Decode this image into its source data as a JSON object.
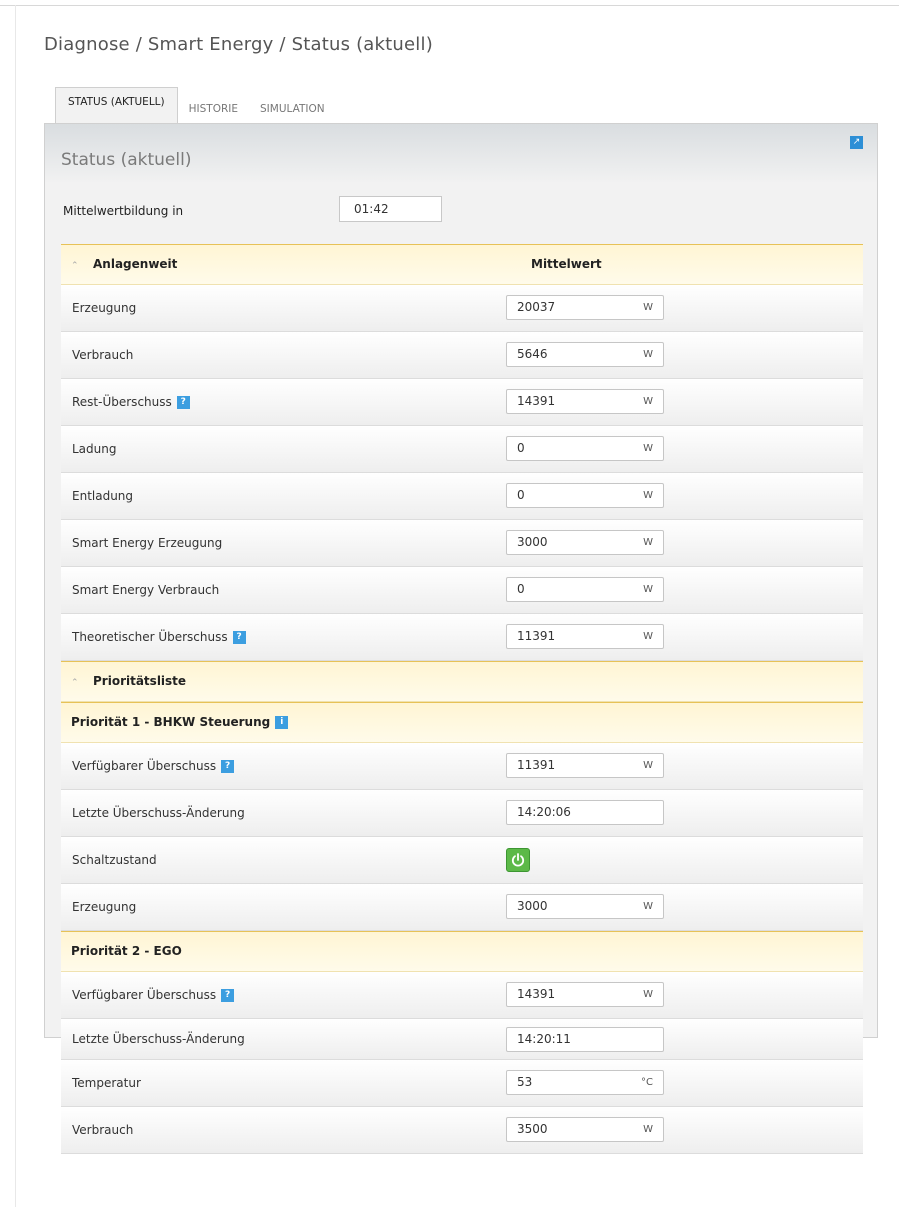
{
  "breadcrumb": "Diagnose / Smart Energy / Status (aktuell)",
  "tabs": [
    {
      "label": "STATUS (AKTUELL)",
      "active": true
    },
    {
      "label": "HISTORIE",
      "active": false
    },
    {
      "label": "SIMULATION",
      "active": false
    }
  ],
  "panel_title": "Status (aktuell)",
  "averaging": {
    "label": "Mittelwertbildung in",
    "value": "01:42"
  },
  "plant": {
    "header_label": "Anlagenweit",
    "column_header": "Mittelwert",
    "rows": [
      {
        "label": "Erzeugung",
        "value": "20037",
        "unit": "W"
      },
      {
        "label": "Verbrauch",
        "value": "5646",
        "unit": "W"
      },
      {
        "label": "Rest-Überschuss",
        "value": "14391",
        "unit": "W"
      },
      {
        "label": "Ladung",
        "value": "0",
        "unit": "W"
      },
      {
        "label": "Entladung",
        "value": "0",
        "unit": "W"
      },
      {
        "label": "Smart Energy Erzeugung",
        "value": "3000",
        "unit": "W"
      },
      {
        "label": "Smart Energy Verbrauch",
        "value": "0",
        "unit": "W"
      },
      {
        "label": "Theoretischer Überschuss",
        "value": "11391",
        "unit": "W"
      }
    ]
  },
  "priority_list": {
    "header_label": "Prioritätsliste",
    "p1": {
      "title": "Priorität 1 - BHKW Steuerung",
      "rows": [
        {
          "label": "Verfügbarer Überschuss",
          "value": "11391",
          "unit": "W"
        },
        {
          "label": "Letzte Überschuss-Änderung",
          "value": "14:20:06"
        },
        {
          "label": "Schaltzustand",
          "state": "on"
        },
        {
          "label": "Erzeugung",
          "value": "3000",
          "unit": "W"
        }
      ]
    },
    "p2": {
      "title": "Priorität 2 - EGO",
      "rows": [
        {
          "label": "Verfügbarer Überschuss",
          "value": "14391",
          "unit": "W"
        },
        {
          "label": "Letzte Überschuss-Änderung",
          "value": "14:20:11"
        },
        {
          "label": "Temperatur",
          "value": "53",
          "unit": "°C"
        },
        {
          "label": "Verbrauch",
          "value": "3500",
          "unit": "W"
        }
      ]
    }
  },
  "icons": {
    "help": "help-icon",
    "info": "info-icon",
    "power": "power-icon",
    "collapse": "collapse-icon",
    "corner": "export-icon"
  },
  "colors": {
    "accent": "#3c9ee0",
    "power_on": "#5cb948",
    "section_border": "#e7c257"
  }
}
